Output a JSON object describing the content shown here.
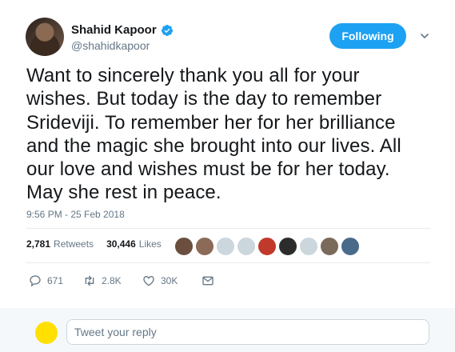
{
  "user": {
    "display_name": "Shahid Kapoor",
    "handle": "@shahidkapoor",
    "verified": true
  },
  "follow_button": {
    "label": "Following"
  },
  "tweet": {
    "text": "Want to sincerely thank you all for your\nwishes. But today is the day to remember\nSrideviji. To remember her for her brilliance\nand the magic she brought into our lives. All\nour love and wishes must be for her today.\nMay she rest in peace.",
    "timestamp": "9:56 PM - 25 Feb 2018"
  },
  "stats": {
    "retweets_count": "2,781",
    "retweets_label": "Retweets",
    "likes_count": "30,446",
    "likes_label": "Likes"
  },
  "liker_avatars": [
    "#6b4e3d",
    "#8c6a58",
    "#ccd6dd",
    "#ccd6dd",
    "#c0392b",
    "#2c2c2c",
    "#ccd6dd",
    "#7a6a5a",
    "#4a6a8a"
  ],
  "actions": {
    "reply_count": "671",
    "retweet_count": "2.8K",
    "like_count": "30K"
  },
  "reply": {
    "placeholder": "Tweet your reply"
  },
  "colors": {
    "accent": "#1da1f2",
    "muted": "#657786"
  }
}
